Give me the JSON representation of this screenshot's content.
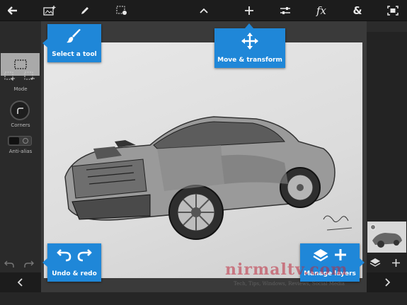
{
  "toolbar": {
    "icons": [
      "arrow-left-icon",
      "image-add-icon",
      "pencil-icon",
      "selection-settings-icon",
      "chevron-up-icon",
      "plus-icon",
      "adjustments-icon",
      "fx-icon",
      "ampersand-icon",
      "fit-screen-icon"
    ],
    "fx_text": "fx",
    "amp_text": "&"
  },
  "left_panel": {
    "mode_label": "Mode",
    "corners_label": "Corners",
    "antialias_label": "Anti-alias"
  },
  "callouts": {
    "select_tool": "Select a tool",
    "move_transform": "Move & transform",
    "undo_redo": "Undo & redo",
    "manage_layers": "Manage layers"
  },
  "watermark": {
    "name": "nirmaltv.com",
    "tagline": "Tech, Tips, Windows, Reviews, Social Media"
  },
  "colors": {
    "accent": "#1f87d8",
    "toolbar_bg": "#1c1c1c",
    "panel_bg": "#2a2a2a"
  }
}
